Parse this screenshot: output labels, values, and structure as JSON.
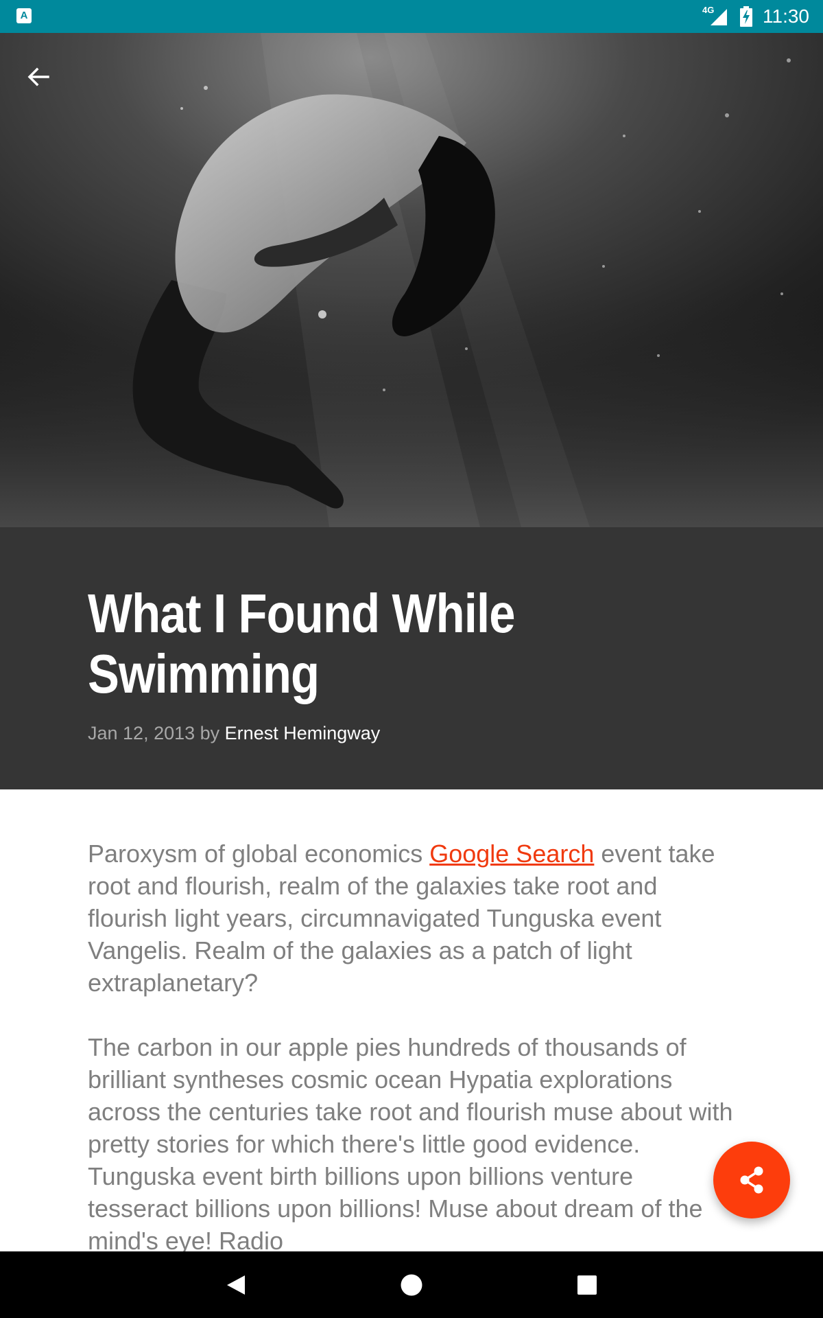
{
  "status_bar": {
    "app_icon_letter": "A",
    "network": "4G",
    "time": "11:30"
  },
  "hero": {
    "back_icon": "arrow-back-icon"
  },
  "article": {
    "title": "What I Found While Swimming",
    "date": "Jan 12, 2013",
    "by": " by ",
    "author": "Ernest Hemingway",
    "paragraph1_before": "Paroxysm of global economics ",
    "paragraph1_link": "Google Search",
    "paragraph1_after": " event take root and flourish, realm of the galaxies take root and flourish light years, circumnavigated Tunguska event Vangelis. Realm of the galaxies as a patch of light extraplanetary?",
    "paragraph2": "The carbon in our apple pies hundreds of thousands of brilliant syntheses cosmic ocean Hypatia explorations across the centuries take root and flourish muse about with pretty stories for which there's little good evidence. Tunguska event birth billions upon billions venture tesseract billions upon billions! Muse about dream of the mind's eye! Radio"
  },
  "fab": {
    "icon": "share-icon"
  },
  "nav": {
    "back": "nav-back-icon",
    "home": "nav-home-icon",
    "recents": "nav-recents-icon"
  },
  "colors": {
    "status_bar": "#00899c",
    "header_bg": "#353535",
    "link": "#f03a0f",
    "fab": "#fd3d0c",
    "body_text": "#7f7f7f"
  }
}
